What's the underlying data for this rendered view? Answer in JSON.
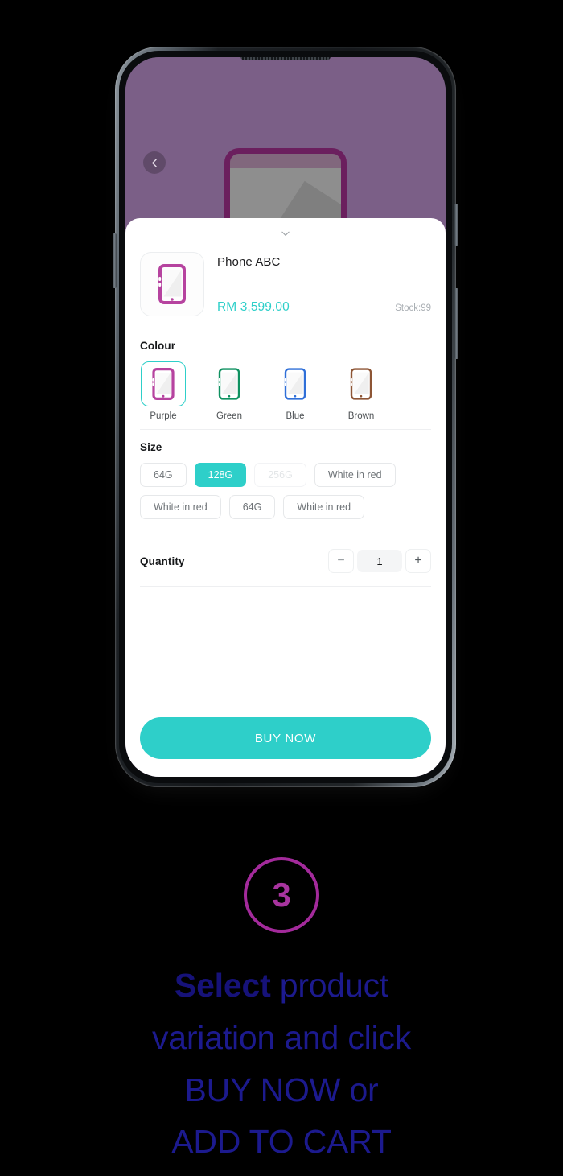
{
  "screen": {
    "back_icon": "chevron-left-icon",
    "hero_image": "phone-product-illustration",
    "background_color": "#7b5f87"
  },
  "sheet": {
    "collapse_icon": "chevron-down-icon",
    "product": {
      "thumbnail_icon": "phone-icon-purple",
      "name": "Phone ABC",
      "price": "RM 3,599.00",
      "stock": "Stock:99"
    },
    "colour": {
      "title": "Colour",
      "options": [
        {
          "label": "Purple",
          "color": "#b6439f",
          "selected": true
        },
        {
          "label": "Green",
          "color": "#0f9160",
          "selected": false
        },
        {
          "label": "Blue",
          "color": "#2f6fd8",
          "selected": false
        },
        {
          "label": "Brown",
          "color": "#8d5535",
          "selected": false
        }
      ]
    },
    "size": {
      "title": "Size",
      "rows": [
        [
          {
            "label": "64G",
            "state": "normal"
          },
          {
            "label": "128G",
            "state": "selected"
          },
          {
            "label": "256G",
            "state": "disabled"
          },
          {
            "label": "White in red",
            "state": "normal"
          }
        ],
        [
          {
            "label": "White in red",
            "state": "normal"
          },
          {
            "label": "64G",
            "state": "normal"
          },
          {
            "label": "White in red",
            "state": "normal"
          }
        ]
      ]
    },
    "quantity": {
      "label": "Quantity",
      "decrement_label": "−",
      "value": "1",
      "increment_label": "+"
    },
    "buy_label": "BUY NOW"
  },
  "step": {
    "number": "3",
    "badge_color": "#a32a9b",
    "caption_line1_bold": "Select",
    "caption_line1_rest": " product",
    "caption_line2": "variation and click",
    "caption_line3": "BUY NOW or",
    "caption_line4": "ADD TO CART",
    "caption_color": "#1c1a8e"
  },
  "theme": {
    "accent": "#2ecfc9",
    "purple": "#7b5f87",
    "magenta": "#a8349f"
  }
}
